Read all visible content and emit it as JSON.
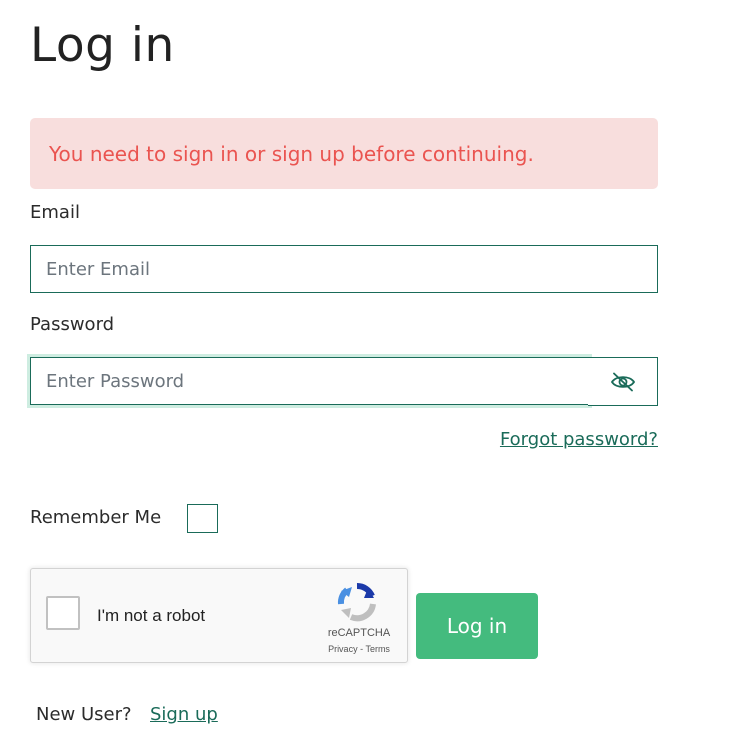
{
  "page": {
    "title": "Log in"
  },
  "alert": {
    "message": "You need to sign in or sign up before continuing.",
    "color": "#ea5450",
    "background": "#f8dedd"
  },
  "form": {
    "email_label": "Email",
    "email_placeholder": "Enter Email",
    "email_value": "",
    "password_label": "Password",
    "password_placeholder": "Enter Password",
    "password_value": "",
    "password_toggle_icon": "eye-slash-icon",
    "forgot_label": "Forgot password?",
    "remember_label": "Remember Me",
    "remember_checked": false,
    "submit_label": "Log in"
  },
  "recaptcha": {
    "label": "I'm not a robot",
    "brand": "reCAPTCHA",
    "privacy": "Privacy",
    "separator": "-",
    "terms": "Terms"
  },
  "footer": {
    "new_user_text": "New User?",
    "signup_label": "Sign up"
  },
  "colors": {
    "accent": "#1a6b59",
    "button": "#44bb7e"
  }
}
